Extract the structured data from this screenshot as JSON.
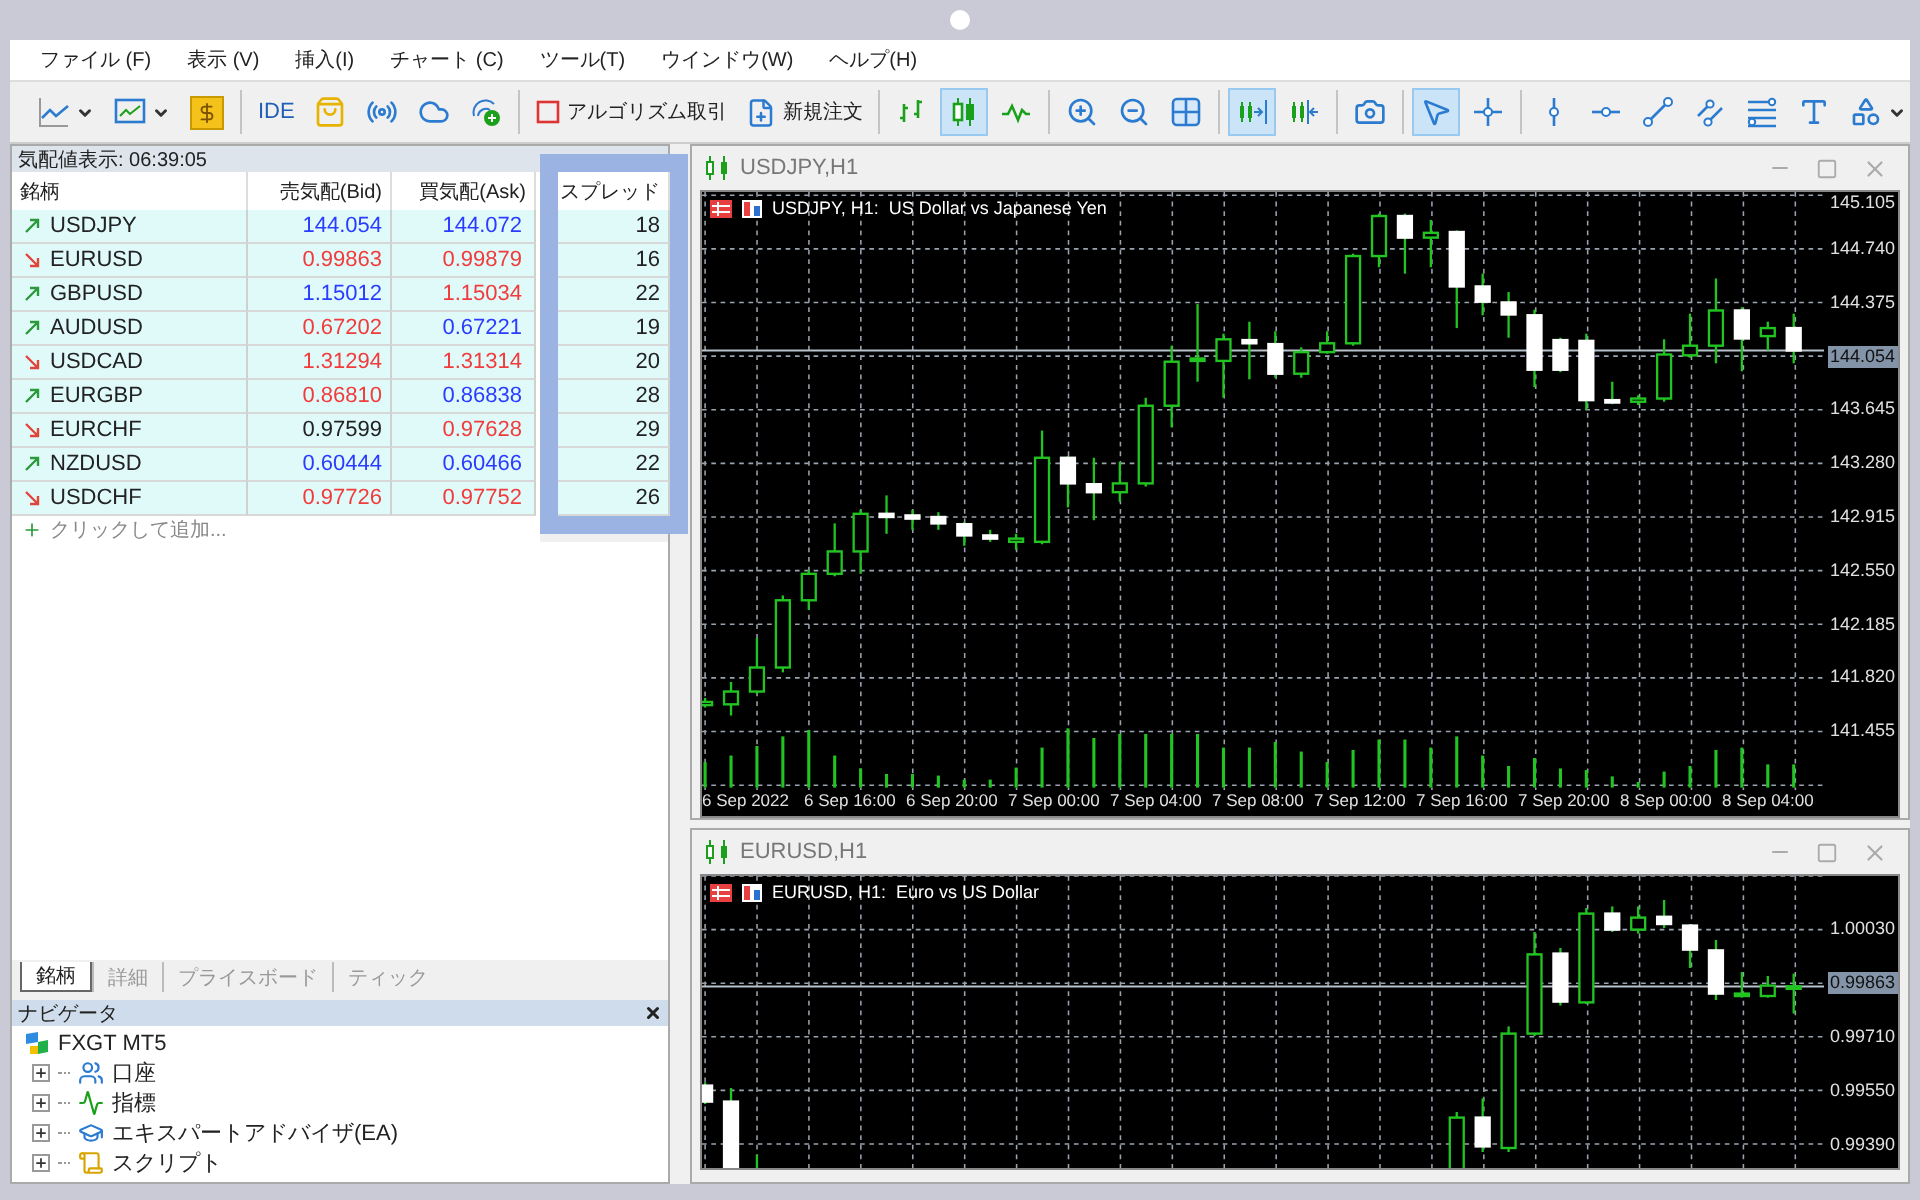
{
  "menu": [
    "ファイル (F)",
    "表示 (V)",
    "挿入(I)",
    "チャート (C)",
    "ツール(T)",
    "ウインドウ(W)",
    "ヘルプ(H)"
  ],
  "toolbar": [
    [
      {
        "kind": "dropdown",
        "pressed": false
      },
      {
        "kind": "dropdown",
        "pressed": false
      },
      {
        "kind": "icon",
        "pressed": false
      }
    ],
    [
      {
        "kind": "label",
        "label": "IDE",
        "pressed": false
      },
      {
        "kind": "icon",
        "pressed": false
      },
      {
        "kind": "icon",
        "pressed": false
      },
      {
        "kind": "icon",
        "pressed": false
      },
      {
        "kind": "icon",
        "pressed": false
      }
    ],
    [
      {
        "kind": "labeled",
        "label": "アルゴリズム取引",
        "pressed": false
      },
      {
        "kind": "labeled",
        "label": "新規注文",
        "pressed": false
      }
    ],
    [
      {
        "kind": "icon",
        "pressed": false
      },
      {
        "kind": "icon",
        "pressed": true
      },
      {
        "kind": "icon",
        "pressed": false
      }
    ],
    [
      {
        "kind": "icon",
        "pressed": false
      },
      {
        "kind": "icon",
        "pressed": false
      },
      {
        "kind": "icon",
        "pressed": false
      }
    ],
    [
      {
        "kind": "icon",
        "pressed": true
      },
      {
        "kind": "icon",
        "pressed": false
      }
    ],
    [
      {
        "kind": "icon",
        "pressed": false
      }
    ],
    [
      {
        "kind": "icon",
        "pressed": true
      },
      {
        "kind": "icon",
        "pressed": false
      }
    ],
    [
      {
        "kind": "icon",
        "pressed": false
      },
      {
        "kind": "icon",
        "pressed": false
      },
      {
        "kind": "icon",
        "pressed": false
      },
      {
        "kind": "icon",
        "pressed": false
      },
      {
        "kind": "icon",
        "pressed": false
      },
      {
        "kind": "icon",
        "pressed": false
      },
      {
        "kind": "dropdown",
        "pressed": false
      }
    ]
  ],
  "market_watch": {
    "title": "気配値表示: 06:39:05",
    "columns": [
      "銘柄",
      "売気配(Bid)",
      "買気配(Ask)",
      "スプレッド"
    ],
    "rows": [
      {
        "symbol": "USDJPY",
        "rising": true,
        "bid": {
          "value": "144.054",
          "color": "#2a3cff"
        },
        "ask": {
          "value": "144.072",
          "color": "#2a3cff"
        },
        "spread": "18"
      },
      {
        "symbol": "EURUSD",
        "rising": false,
        "bid": {
          "value": "0.99863",
          "color": "#f03c3c"
        },
        "ask": {
          "value": "0.99879",
          "color": "#f03c3c"
        },
        "spread": "16"
      },
      {
        "symbol": "GBPUSD",
        "rising": true,
        "bid": {
          "value": "1.15012",
          "color": "#2a3cff"
        },
        "ask": {
          "value": "1.15034",
          "color": "#f03c3c"
        },
        "spread": "22"
      },
      {
        "symbol": "AUDUSD",
        "rising": true,
        "bid": {
          "value": "0.67202",
          "color": "#f03c3c"
        },
        "ask": {
          "value": "0.67221",
          "color": "#2a3cff"
        },
        "spread": "19"
      },
      {
        "symbol": "USDCAD",
        "rising": false,
        "bid": {
          "value": "1.31294",
          "color": "#f03c3c"
        },
        "ask": {
          "value": "1.31314",
          "color": "#f03c3c"
        },
        "spread": "20"
      },
      {
        "symbol": "EURGBP",
        "rising": true,
        "bid": {
          "value": "0.86810",
          "color": "#f03c3c"
        },
        "ask": {
          "value": "0.86838",
          "color": "#2a3cff"
        },
        "spread": "28"
      },
      {
        "symbol": "EURCHF",
        "rising": false,
        "bid": {
          "value": "0.97599",
          "color": "#222222"
        },
        "ask": {
          "value": "0.97628",
          "color": "#f03c3c"
        },
        "spread": "29"
      },
      {
        "symbol": "NZDUSD",
        "rising": true,
        "bid": {
          "value": "0.60444",
          "color": "#2a3cff"
        },
        "ask": {
          "value": "0.60466",
          "color": "#2a3cff"
        },
        "spread": "22"
      },
      {
        "symbol": "USDCHF",
        "rising": false,
        "bid": {
          "value": "0.97726",
          "color": "#f03c3c"
        },
        "ask": {
          "value": "0.97752",
          "color": "#f03c3c"
        },
        "spread": "26"
      }
    ],
    "add_row": "クリックして追加...",
    "spread_highlight": true,
    "tabs": [
      {
        "label": "銘柄",
        "selected": true
      },
      {
        "label": "詳細",
        "selected": false
      },
      {
        "label": "プライスボード",
        "selected": false
      },
      {
        "label": "ティック",
        "selected": false
      }
    ]
  },
  "navigator": {
    "title": "ナビゲータ",
    "root": {
      "label": "FXGT MT5",
      "children": [
        {
          "label": "口座",
          "expanded": false
        },
        {
          "label": "指標",
          "expanded": false
        },
        {
          "label": "エキスパートアドバイザ(EA)",
          "expanded": false
        },
        {
          "label": "スクリプト",
          "expanded": false
        }
      ]
    }
  },
  "charts": [
    {
      "window_title": "USDJPY,H1",
      "caption": "USDJPY, H1:  US Dollar vs Japanese Yen",
      "price_axis": [
        {
          "label": "145.105",
          "current": false
        },
        {
          "label": "144.740",
          "current": false
        },
        {
          "label": "144.375",
          "current": false
        },
        {
          "label": "144.054",
          "current": true
        },
        {
          "label": "143.645",
          "current": false
        },
        {
          "label": "143.280",
          "current": false
        },
        {
          "label": "142.915",
          "current": false
        },
        {
          "label": "142.550",
          "current": false
        },
        {
          "label": "142.185",
          "current": false
        },
        {
          "label": "141.820",
          "current": false
        },
        {
          "label": "141.455",
          "current": false
        }
      ],
      "time_axis": [
        "6 Sep 2022",
        "6 Sep 16:00",
        "6 Sep 20:00",
        "7 Sep 00:00",
        "7 Sep 04:00",
        "7 Sep 08:00",
        "7 Sep 12:00",
        "7 Sep 16:00",
        "7 Sep 20:00",
        "8 Sep 00:00",
        "8 Sep 04:00"
      ]
    },
    {
      "window_title": "EURUSD,H1",
      "caption": "EURUSD, H1:  Euro vs US Dollar",
      "price_axis": [
        {
          "label": "1.00030",
          "current": false
        },
        {
          "label": "0.99863",
          "current": true
        },
        {
          "label": "0.99710",
          "current": false
        },
        {
          "label": "0.99550",
          "current": false
        },
        {
          "label": "0.99390",
          "current": false
        }
      ]
    }
  ]
}
